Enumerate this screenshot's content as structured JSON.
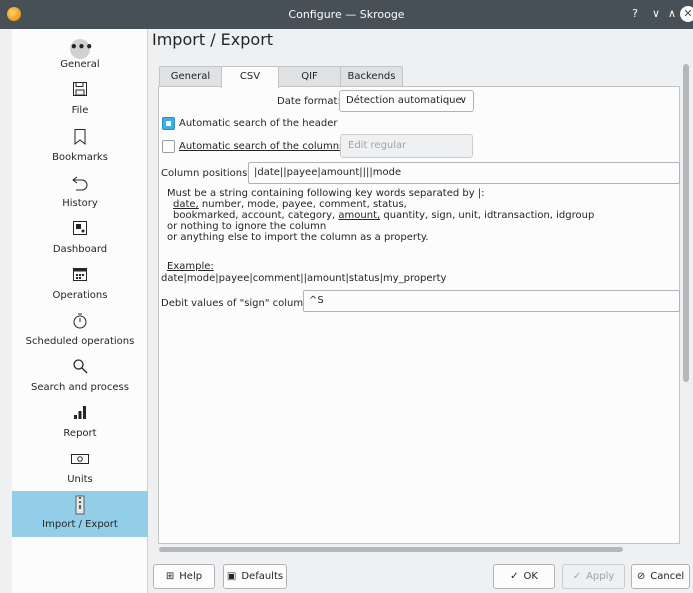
{
  "window": {
    "title": "Configure — Skrooge",
    "help": "?",
    "minimize": "∨",
    "maximize": "∧",
    "close": "✕"
  },
  "sidebar": {
    "items": [
      {
        "label": "General",
        "icon": "more-icon"
      },
      {
        "label": "File",
        "icon": "save-icon"
      },
      {
        "label": "Bookmarks",
        "icon": "bookmark-icon"
      },
      {
        "label": "History",
        "icon": "undo-icon"
      },
      {
        "label": "Dashboard",
        "icon": "dashboard-icon"
      },
      {
        "label": "Operations",
        "icon": "calendar-icon"
      },
      {
        "label": "Scheduled operations",
        "icon": "timer-icon"
      },
      {
        "label": "Search and process",
        "icon": "search-icon"
      },
      {
        "label": "Report",
        "icon": "bar-chart-icon"
      },
      {
        "label": "Units",
        "icon": "money-icon"
      },
      {
        "label": "Import / Export",
        "icon": "zip-icon",
        "active": true
      }
    ]
  },
  "page": {
    "title": "Import / Export"
  },
  "tabs": [
    "General",
    "CSV",
    "QIF",
    "Backends"
  ],
  "csv": {
    "date_format_label": "Date format:",
    "date_format_value": "Détection automatique",
    "auto_header_label": "Automatic search of the header",
    "auto_header_checked": true,
    "auto_columns_label": "Automatic search of the columns",
    "auto_columns_checked": false,
    "edit_regex_label": "Edit regular expressions...",
    "column_positions_label": "Column positions:",
    "column_positions_value": "|date||payee|amount||||mode",
    "help_line1": "Must be a string containing following key words separated by |:",
    "help_line2_a": "date,",
    "help_line2_b": " number, mode, payee, comment, status,",
    "help_line3_a": "bookmarked, account, category, ",
    "help_line3_b": "amount,",
    "help_line3_c": " quantity, sign, unit, idtransaction, idgroup",
    "help_line4": "or nothing to ignore the column",
    "help_line5": "or anything else to import the column as a property.",
    "example_label": "Example:",
    "example_value": "date|mode|payee|comment||amount|status|my_property",
    "debit_label": "Debit values of \"sign\" column:",
    "debit_value": "^S"
  },
  "buttons": {
    "help": "Help",
    "defaults": "Defaults",
    "ok": "OK",
    "apply": "Apply",
    "cancel": "Cancel"
  },
  "colors": {
    "accent": "#3daee9",
    "selection": "#93cee9",
    "titlebar": "#475057"
  }
}
